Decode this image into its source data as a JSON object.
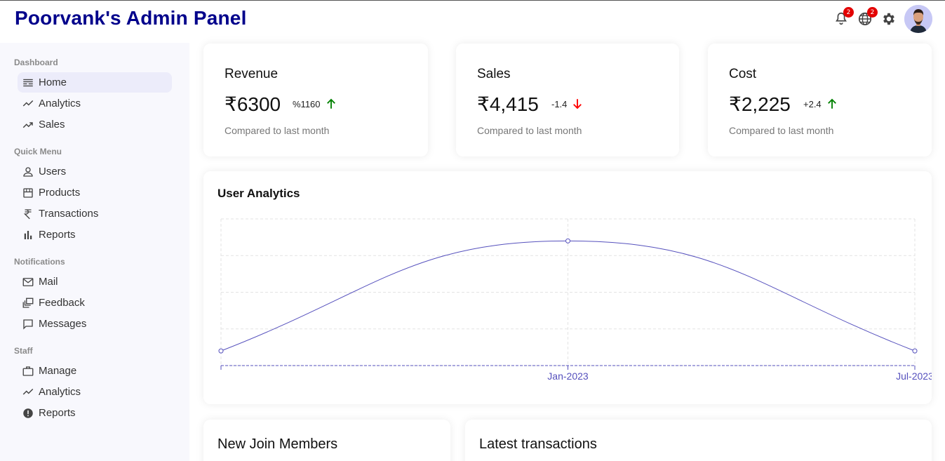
{
  "header": {
    "title": "Poorvank's Admin Panel",
    "notifications_badge": "2",
    "language_badge": "2"
  },
  "sidebar": {
    "sections": [
      {
        "title": "Dashboard",
        "items": [
          {
            "label": "Home",
            "icon": "timeline-icon",
            "active": true
          },
          {
            "label": "Analytics",
            "icon": "trending-up-icon"
          },
          {
            "label": "Sales",
            "icon": "trending-up-icon"
          }
        ]
      },
      {
        "title": "Quick Menu",
        "items": [
          {
            "label": "Users",
            "icon": "person-icon"
          },
          {
            "label": "Products",
            "icon": "storefront-icon"
          },
          {
            "label": "Transactions",
            "icon": "rupee-icon"
          },
          {
            "label": "Reports",
            "icon": "bar-chart-icon"
          }
        ]
      },
      {
        "title": "Notifications",
        "items": [
          {
            "label": "Mail",
            "icon": "mail-icon"
          },
          {
            "label": "Feedback",
            "icon": "dynamic-feed-icon"
          },
          {
            "label": "Messages",
            "icon": "chat-bubble-icon"
          }
        ]
      },
      {
        "title": "Staff",
        "items": [
          {
            "label": "Manage",
            "icon": "work-icon"
          },
          {
            "label": "Analytics",
            "icon": "timeline-icon"
          },
          {
            "label": "Reports",
            "icon": "report-icon"
          }
        ]
      }
    ]
  },
  "featured": [
    {
      "title": "Revenue",
      "money": "₹6300",
      "rate": "%1160",
      "trend": "up",
      "sub": "Compared to last month"
    },
    {
      "title": "Sales",
      "money": "₹4,415",
      "rate": "-1.4",
      "trend": "down",
      "sub": "Compared to last month"
    },
    {
      "title": "Cost",
      "money": "₹2,225",
      "rate": "+2.4",
      "trend": "up",
      "sub": "Compared to last month"
    }
  ],
  "colors": {
    "brand": "#00008b",
    "chart_line": "#5550bd",
    "up": "#008000",
    "down": "#ff0000",
    "badge": "#e30000"
  },
  "chart_data": {
    "type": "line",
    "title": "User Analytics",
    "x": [
      "",
      "Jan-2023",
      "Jul-2023"
    ],
    "series": [
      {
        "values": [
          0.1,
          0.85,
          0.1
        ]
      }
    ],
    "ylim": [
      0,
      1
    ],
    "grid": true,
    "smooth": true
  },
  "widgets": {
    "members_title": "New Join Members",
    "transactions_title": "Latest transactions"
  }
}
